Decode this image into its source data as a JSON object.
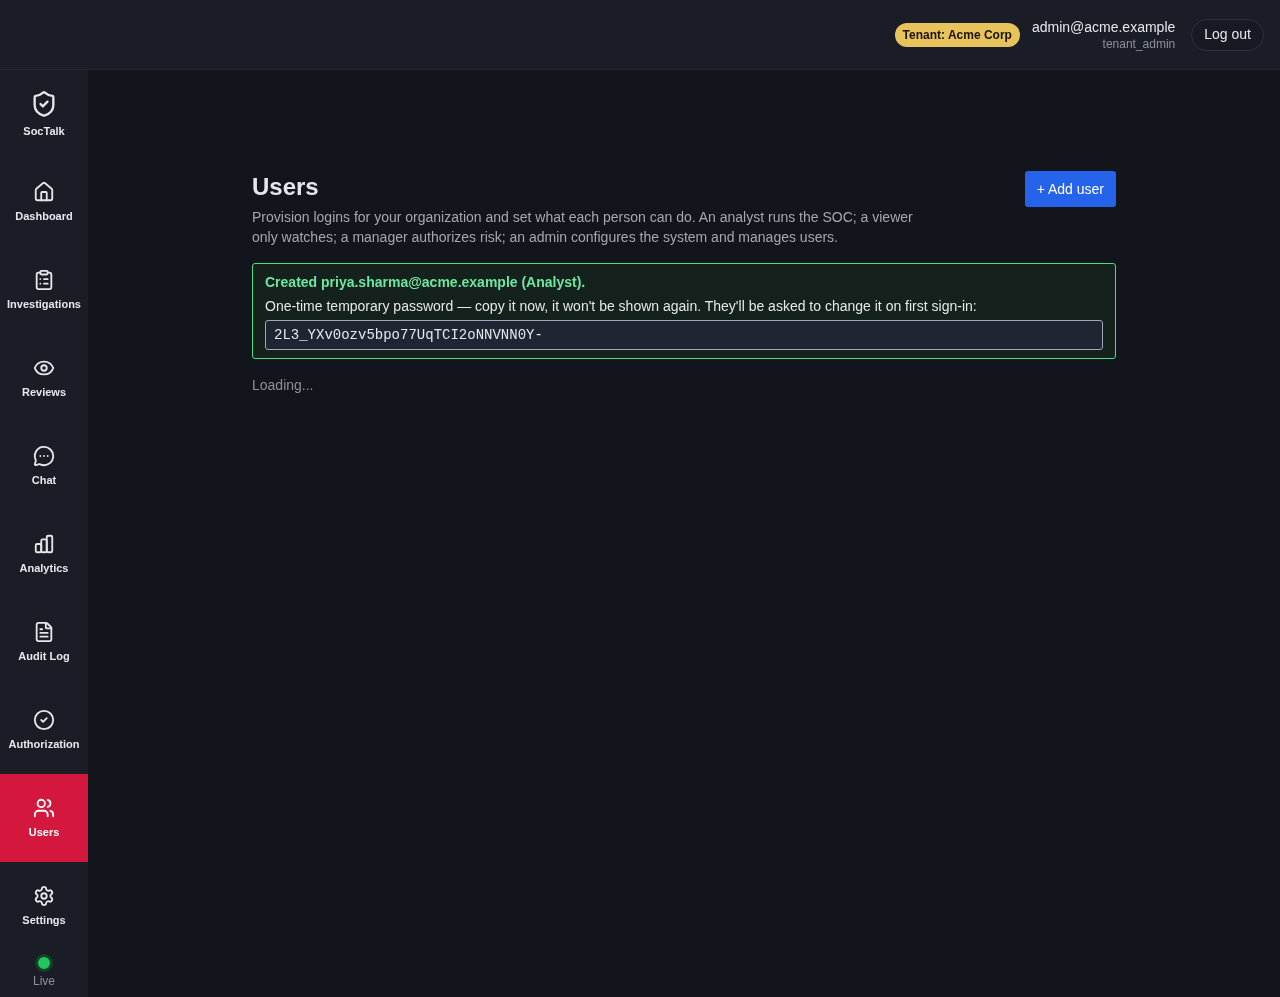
{
  "header": {
    "tenant_badge": "Tenant: Acme Corp",
    "user": {
      "email": "admin@acme.example",
      "role": "tenant_admin"
    },
    "logout_button": "Log out"
  },
  "sidebar": {
    "brand": "SocTalk",
    "items": [
      {
        "label": "Dashboard",
        "selected": false
      },
      {
        "label": "Investigations",
        "selected": false
      },
      {
        "label": "Reviews",
        "selected": false
      },
      {
        "label": "Chat",
        "selected": false
      },
      {
        "label": "Analytics",
        "selected": false
      },
      {
        "label": "Audit Log",
        "selected": false
      },
      {
        "label": "Authorization",
        "selected": false
      },
      {
        "label": "Users",
        "selected": true
      },
      {
        "label": "Settings",
        "selected": false
      }
    ],
    "status": {
      "label": "Live",
      "connected": true
    }
  },
  "page": {
    "title": "Users",
    "description": "Provision logins for your organization and set what each person can do. An analyst runs the SOC; a viewer only watches; a manager authorizes risk; an admin configures the system and manages users.",
    "add_button": "+ Add user",
    "notice": {
      "heading": "Created priya.sharma@acme.example (Analyst).",
      "message": "One-time temporary password — copy it now, it won't be shown again. They'll be asked to change it on first sign-in:",
      "password": "2L3_YXv0ozv5bpo77UqTCI2oNNVNN0Y-"
    },
    "loading": "Loading..."
  }
}
